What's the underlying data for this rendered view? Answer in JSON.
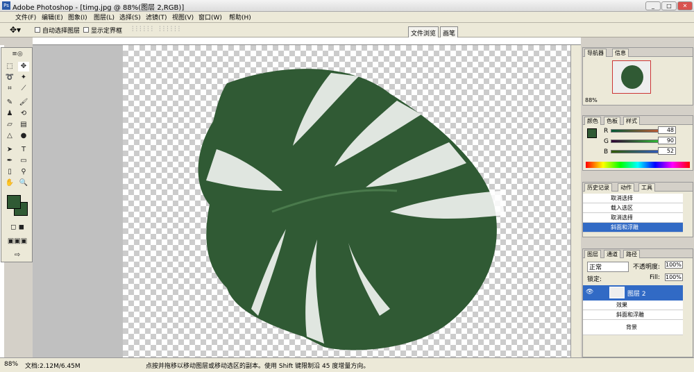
{
  "window": {
    "title": "Adobe Photoshop - [timg.jpg @ 88%(图层 2,RGB)]"
  },
  "menu": [
    "文件(F)",
    "编辑(E)",
    "图象(I)",
    "图层(L)",
    "选择(S)",
    "滤镜(T)",
    "视图(V)",
    "窗口(W)",
    "帮助(H)"
  ],
  "options": {
    "auto_select": "自动选择图层",
    "show_bounds": "显示定界框"
  },
  "well_tabs": {
    "browser": "文件浏览",
    "brush": "画笔"
  },
  "status": {
    "zoom": "88%",
    "doc": "文档:2.12M/6.45M",
    "hint": "点按并拖移以移动图层或移动选区的副本。使用 Shift 键限制沿 45 度增量方向。"
  },
  "navigator": {
    "tabs": [
      "导航器",
      "信息"
    ],
    "zoom": "88%"
  },
  "color": {
    "tabs": [
      "颜色",
      "色板",
      "样式"
    ],
    "r_label": "R",
    "g_label": "G",
    "b_label": "B",
    "r": "48",
    "g": "90",
    "b": "52",
    "fg": "#305a34"
  },
  "history": {
    "tabs": [
      "历史记录",
      "动作",
      "工具"
    ],
    "items": [
      "取消选择",
      "载入选区",
      "取消选择",
      "斜面和浮雕"
    ]
  },
  "layers": {
    "tabs": [
      "图层",
      "通道",
      "路径"
    ],
    "mode": "正常",
    "opacity_label": "不透明度:",
    "opacity": "100%",
    "lock_label": "锁定:",
    "fill_label": "Fill:",
    "fill": "100%",
    "layer2": "图层 2",
    "effects": "效果",
    "bevel": "斜面和浮雕",
    "background": "背景"
  },
  "colors": {
    "leaf": "#305a34",
    "selection": "#316ac5"
  }
}
